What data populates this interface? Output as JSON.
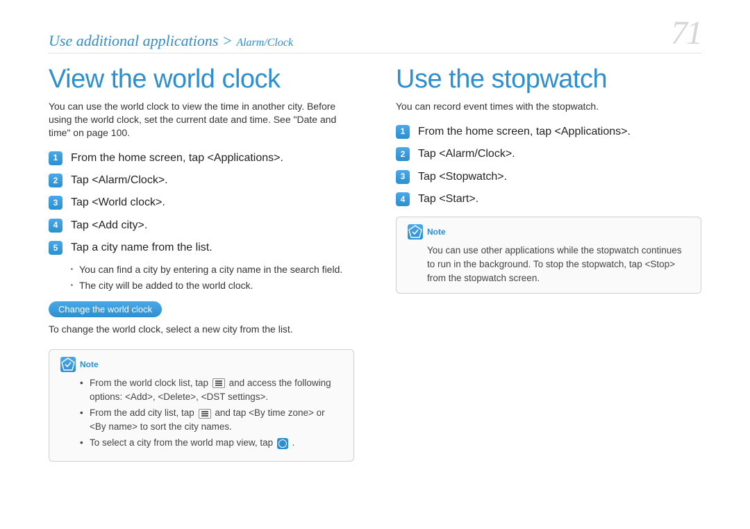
{
  "header": {
    "breadcrumb_main": "Use additional applications",
    "breadcrumb_sep": " > ",
    "breadcrumb_sub": "Alarm/Clock",
    "page_number": "71"
  },
  "left": {
    "title": "View the world clock",
    "intro": "You can use the world clock to view the time in another city. Before using the world clock, set the current date and time. See \"Date and time\" on page 100.",
    "steps": [
      "From the home screen, tap <Applications>.",
      "Tap <Alarm/Clock>.",
      "Tap <World clock>.",
      "Tap <Add city>.",
      "Tap a city name from the list."
    ],
    "sub_bullets": [
      "You can find a city by entering a city name in the search field.",
      "The city will be added to the world clock."
    ],
    "pill": "Change the world clock",
    "pill_after": "To change the world clock, select a new city from the list.",
    "note_label": "Note",
    "note_items": {
      "a_pre": "From the world clock list, tap ",
      "a_post": " and access the following options: <Add>, <Delete>, <DST settings>.",
      "b_pre": "From the add city list, tap ",
      "b_post": " and tap <By time zone> or <By name> to sort the city names.",
      "c_pre": "To select a city from the world map view, tap ",
      "c_post": " ."
    }
  },
  "right": {
    "title": "Use the stopwatch",
    "intro": "You can record event times with the stopwatch.",
    "steps": [
      "From the home screen, tap <Applications>.",
      "Tap <Alarm/Clock>.",
      "Tap <Stopwatch>.",
      "Tap <Start>."
    ],
    "note_label": "Note",
    "note_text": "You can use other applications while the stopwatch continues to run in the background. To stop the stopwatch, tap <Stop> from the stopwatch screen."
  }
}
